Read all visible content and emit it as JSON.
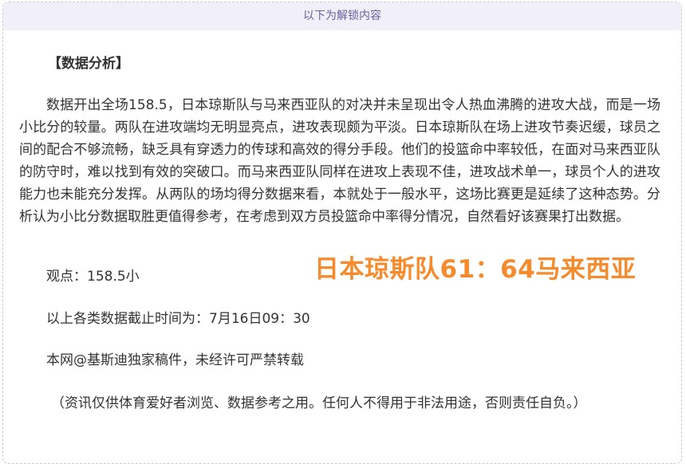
{
  "unlock_bar": {
    "label": "以下为解锁内容"
  },
  "article": {
    "heading": "【数据分析】",
    "body": "数据开出全场158.5，日本琼斯队与马来西亚队的对决并未呈现出令人热血沸腾的进攻大战，而是一场小比分的较量。两队在进攻端均无明显亮点，进攻表现颇为平淡。日本琼斯队在场上进攻节奏迟缓，球员之间的配合不够流畅，缺乏具有穿透力的传球和高效的得分手段。他们的投篮命中率较低，在面对马来西亚队的防守时，难以找到有效的突破口。而马来西亚队同样在进攻上表现不佳，进攻战术单一，球员个人的进攻能力也未能充分发挥。从两队的场均得分数据来看，本就处于一般水平，这场比赛更是延续了这种态势。分析认为小比分数据取胜更值得参考，在考虑到双方员投篮命中率得分情况，自然看好该赛果打出数据。",
    "viewpoint": "观点：158.5小",
    "cutoff": "以上各类数据截止时间为：7月16日09：30",
    "copyright": "本网@基斯迪独家稿件，未经许可严禁转载",
    "disclaimer": "（资讯仅供体育爱好者浏览、数据参考之用。任何人不得用于非法用途，否则责任自负。）"
  },
  "score_overlay": {
    "text": "日本琼斯队61：64马来西亚",
    "color": "#f58b2c"
  }
}
